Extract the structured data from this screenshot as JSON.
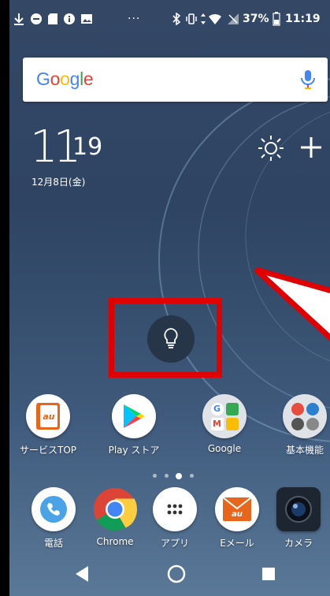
{
  "status_bar": {
    "battery_percent": "37%",
    "time": "11:19",
    "more_glyph": "···"
  },
  "search": {
    "logo_text": "Google",
    "logo_colors": [
      "#4285F4",
      "#EA4335",
      "#FBBC05",
      "#4285F4",
      "#34A853",
      "#EA4335"
    ],
    "mic_icon": "mic-icon"
  },
  "clock": {
    "hour": "11",
    "minute": "19",
    "date": "12月8日(金)"
  },
  "apps_row1": [
    {
      "label": "サービスTOP",
      "icon": "au-icon"
    },
    {
      "label": "Play ストア",
      "icon": "play-store-icon"
    },
    {
      "label": "Google",
      "icon": "google-folder-icon"
    },
    {
      "label": "基本機能",
      "icon": "basic-functions-folder-icon"
    }
  ],
  "dock": [
    {
      "label": "電話",
      "icon": "phone-icon"
    },
    {
      "label": "Chrome",
      "icon": "chrome-icon"
    },
    {
      "label": "アプリ",
      "icon": "app-drawer-icon"
    },
    {
      "label": "Eメール",
      "icon": "email-icon"
    },
    {
      "label": "カメラ",
      "icon": "camera-icon"
    }
  ],
  "colors": {
    "highlight_red": "#e00000",
    "wallpaper_top": "#344866",
    "wallpaper_bottom": "#5a7898"
  }
}
